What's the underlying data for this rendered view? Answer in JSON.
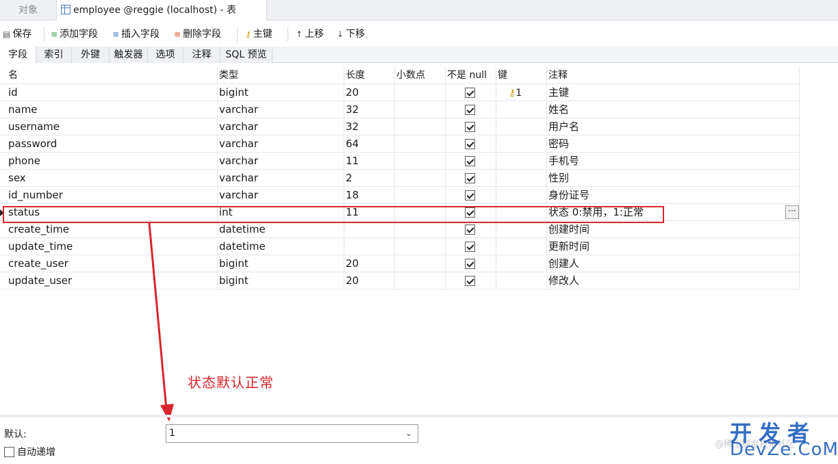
{
  "window_tabs": {
    "objects": "对象",
    "table": "employee @reggie (localhost) - 表"
  },
  "toolbar": {
    "save": "保存",
    "add_field": "添加字段",
    "insert_field": "插入字段",
    "delete_field": "删除字段",
    "primary_key": "主键",
    "move_up": "上移",
    "move_down": "下移"
  },
  "subtabs": [
    "字段",
    "索引",
    "外键",
    "触发器",
    "选项",
    "注释",
    "SQL 预览"
  ],
  "columns": {
    "name": "名",
    "type": "类型",
    "length": "长度",
    "decimals": "小数点",
    "not_null": "不是 null",
    "key": "键",
    "comment": "注释"
  },
  "rows": [
    {
      "name": "id",
      "type": "bigint",
      "length": "20",
      "not_null": true,
      "key": "1",
      "comment": "主键"
    },
    {
      "name": "name",
      "type": "varchar",
      "length": "32",
      "not_null": true,
      "key": "",
      "comment": "姓名"
    },
    {
      "name": "username",
      "type": "varchar",
      "length": "32",
      "not_null": true,
      "key": "",
      "comment": "用户名"
    },
    {
      "name": "password",
      "type": "varchar",
      "length": "64",
      "not_null": true,
      "key": "",
      "comment": "密码"
    },
    {
      "name": "phone",
      "type": "varchar",
      "length": "11",
      "not_null": true,
      "key": "",
      "comment": "手机号"
    },
    {
      "name": "sex",
      "type": "varchar",
      "length": "2",
      "not_null": true,
      "key": "",
      "comment": "性别"
    },
    {
      "name": "id_number",
      "type": "varchar",
      "length": "18",
      "not_null": true,
      "key": "",
      "comment": "身份证号"
    },
    {
      "name": "status",
      "type": "int",
      "length": "11",
      "not_null": true,
      "key": "",
      "comment": "状态 0:禁用，1:正常"
    },
    {
      "name": "create_time",
      "type": "datetime",
      "length": "",
      "not_null": true,
      "key": "",
      "comment": "创建时间"
    },
    {
      "name": "update_time",
      "type": "datetime",
      "length": "",
      "not_null": true,
      "key": "",
      "comment": "更新时间"
    },
    {
      "name": "create_user",
      "type": "bigint",
      "length": "20",
      "not_null": true,
      "key": "",
      "comment": "创建人"
    },
    {
      "name": "update_user",
      "type": "bigint",
      "length": "20",
      "not_null": true,
      "key": "",
      "comment": "修改人"
    }
  ],
  "annotation": "状态默认正常",
  "bottom": {
    "default_label": "默认:",
    "default_value": "1",
    "auto_increment_label": "自动递增"
  },
  "watermark": {
    "small": "@稀土掘金技术社区",
    "big_top": "开发者",
    "big_bottom": "DevZe.CoM"
  },
  "colors": {
    "annotation": "#d9252a",
    "key_icon": "#d4a017",
    "watermark": "#1f5fbf"
  }
}
